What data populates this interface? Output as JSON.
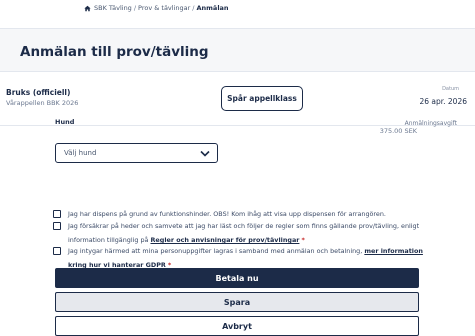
{
  "breadcrumb": {
    "icon": "home-icon",
    "items": [
      "SBK Tävling",
      "Prov & tävlingar",
      "Anmälan"
    ]
  },
  "page": {
    "title": "Anmälan till prov/tävling"
  },
  "event": {
    "name": "Bruks (officiell)",
    "subtitle": "Vårappellen BBK 2026",
    "track_button": "Spår appellklass",
    "date_label": "Datum",
    "date_value": "26 apr. 2026"
  },
  "form": {
    "dog_label": "Hund",
    "dog_placeholder": "Välj hund",
    "fee_label": "Anmälningsavgift",
    "fee_value": "375.00 SEK",
    "checkboxes": [
      {
        "text": "Jag har dispens på grund av funktionshinder. OBS! Kom ihåg att visa upp dispensen för arrangören.",
        "checked": false
      },
      {
        "text_before": "Jag försäkrar på heder och samvete att jag har läst och följer de regler som finns gällande prov/tävling, enligt information tillgänglig på",
        "link": "Regler och anvisningar för prov/tävlingar",
        "required": "*",
        "checked": false
      },
      {
        "text_before": "Jag intygar härmed att mina personuppgifter lagras i samband med anmälan och betalning,",
        "link": "mer information kring hur vi hanterar GDPR",
        "required": "*",
        "checked": false
      }
    ]
  },
  "buttons": {
    "pay": "Betala nu",
    "save": "Spara",
    "cancel": "Avbryt"
  },
  "colors": {
    "primary": "#1c2b48",
    "required": "#c62828",
    "header_bg": "#f6f7f9"
  }
}
